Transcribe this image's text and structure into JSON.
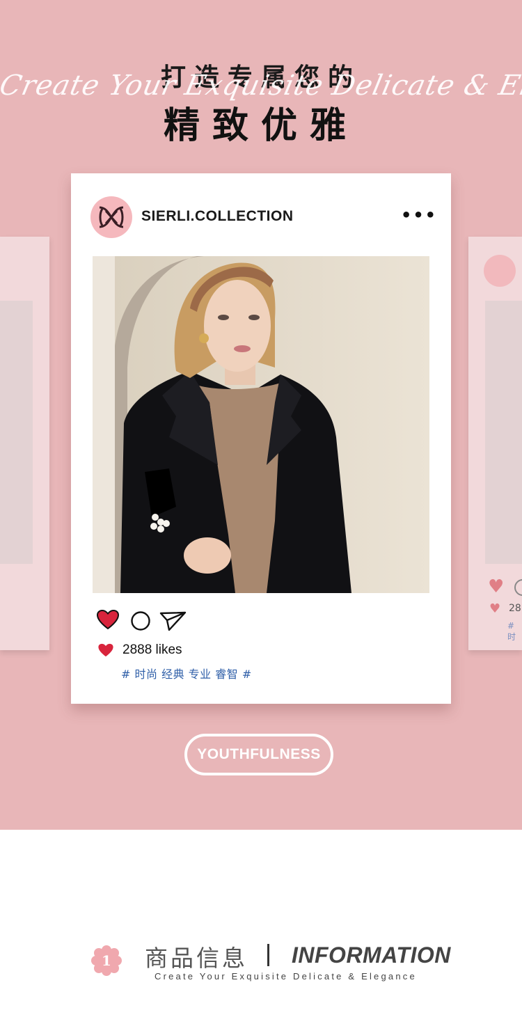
{
  "header": {
    "title_line1": "打造专属您的",
    "script_text": "Create Your Exquisite Delicate & Elegance",
    "title_line2": "精致优雅"
  },
  "post": {
    "handle": "SIERLI.COLLECTION",
    "more_icon": "more-dots-icon",
    "likes": "2888 likes",
    "tags": "# 时尚 经典 专业 睿智 #"
  },
  "side_post": {
    "likes_partial": "28",
    "tag_partial": "# 时"
  },
  "badge": {
    "label": "YOUTHFULNESS"
  },
  "section": {
    "number": "1",
    "title_cn": "商品信息",
    "title_en": "INFORMATION",
    "subtitle": "Create Your Exquisite Delicate & Elegance"
  },
  "colors": {
    "background_pink": "#e8b6b8",
    "heart_red": "#d8243c",
    "tag_blue": "#2f5fa8",
    "flower_pink": "#f0a8ae"
  }
}
